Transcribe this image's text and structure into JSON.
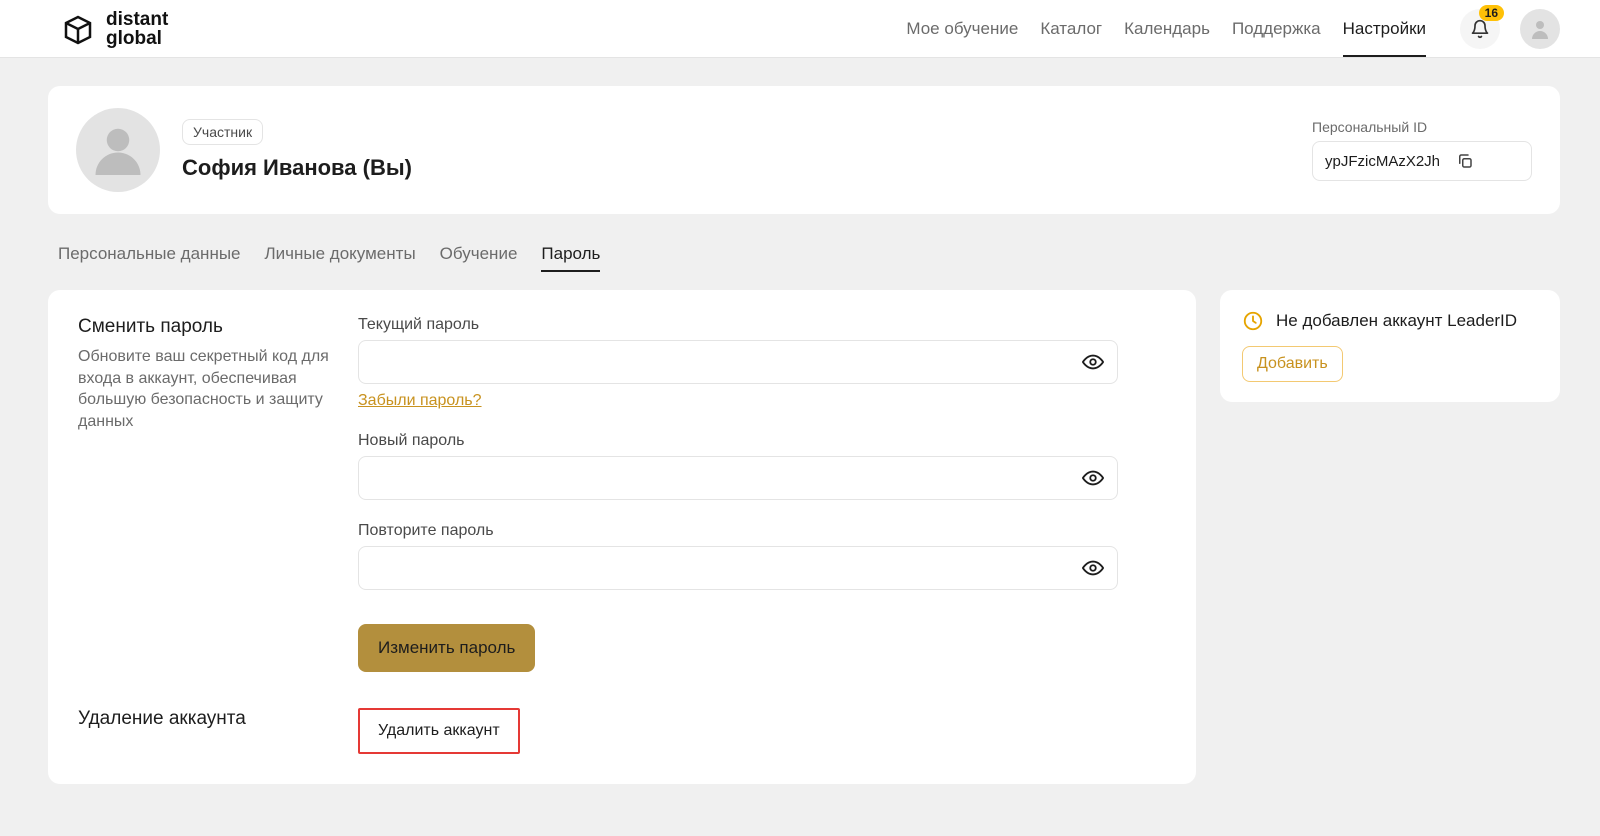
{
  "brand": {
    "line1": "distant",
    "line2": "global"
  },
  "nav": {
    "items": [
      "Мое обучение",
      "Каталог",
      "Календарь",
      "Поддержка",
      "Настройки"
    ],
    "active_index": 4
  },
  "notifications": {
    "count": "16"
  },
  "profile": {
    "role": "Участник",
    "name": "София Иванова (Вы)",
    "personal_id_label": "Персональный ID",
    "personal_id_value": "ypJFzicMAzX2Jh"
  },
  "tabs": {
    "items": [
      "Персональные данные",
      "Личные документы",
      "Обучение",
      "Пароль"
    ],
    "active_index": 3
  },
  "password_section": {
    "title": "Сменить пароль",
    "description": "Обновите ваш секретный код для входа в аккаунт, обеспечивая большую безопасность и защиту данных",
    "current_label": "Текущий пароль",
    "forgot": "Забыли пароль?",
    "new_label": "Новый пароль",
    "repeat_label": "Повторите пароль",
    "submit": "Изменить пароль"
  },
  "delete_section": {
    "title": "Удаление аккаунта",
    "button": "Удалить аккаунт"
  },
  "leaderid": {
    "message": "Не добавлен аккаунт LeaderID",
    "add": "Добавить"
  }
}
